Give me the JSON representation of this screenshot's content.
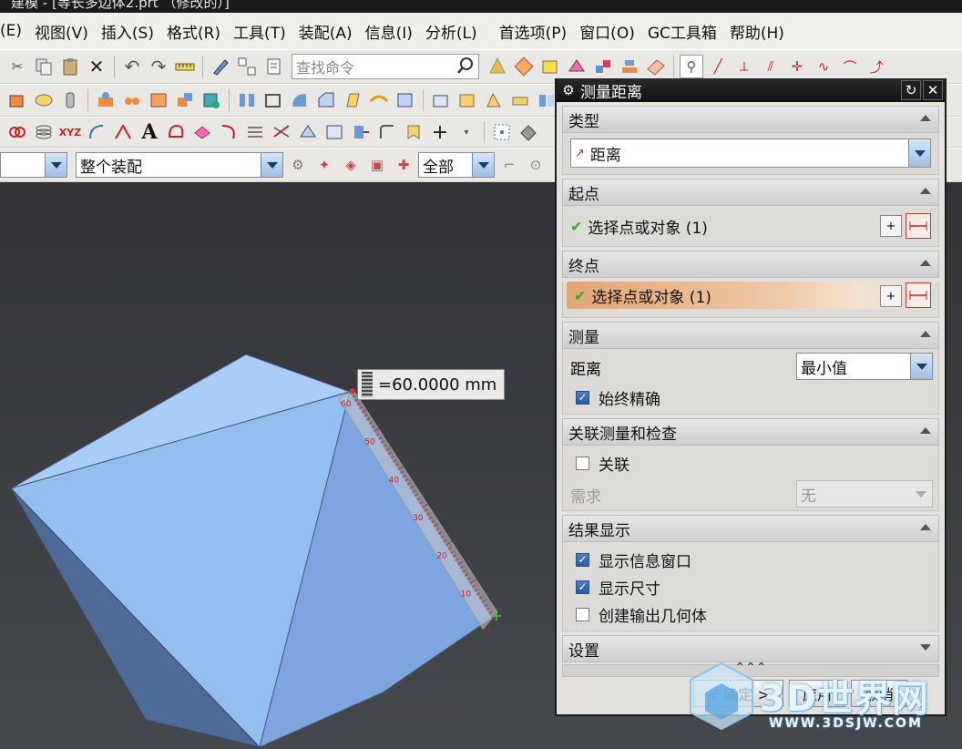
{
  "window": {
    "title": "建模 - [等长多边体2.prt （修改的）]"
  },
  "menu": [
    "(E)",
    "视图(V)",
    "插入(S)",
    "格式(R)",
    "工具(T)",
    "装配(A)",
    "信息(I)",
    "分析(L)",
    "首选项(P)",
    "窗口(O)",
    "GC工具箱",
    "帮助(H)"
  ],
  "toolbar": {
    "search_placeholder": "查找命令",
    "assembly_scope": "整个装配",
    "filter_value": "全部"
  },
  "dimension": {
    "label": "=60.0000 mm"
  },
  "ruler": {
    "ticks": [
      "60",
      "50",
      "40",
      "30",
      "20",
      "10",
      "0"
    ]
  },
  "dialog": {
    "title": "测量距离",
    "sections": {
      "type": {
        "header": "类型",
        "value": "距离"
      },
      "start": {
        "header": "起点",
        "select_label": "选择点或对象 (1)"
      },
      "end": {
        "header": "终点",
        "select_label": "选择点或对象 (1)"
      },
      "measure": {
        "header": "测量",
        "distance_label": "距离",
        "distance_value": "最小值",
        "always_precise": "始终精确"
      },
      "assoc": {
        "header": "关联测量和检查",
        "assoc_label": "关联",
        "require_label": "需求",
        "require_value": "无"
      },
      "result": {
        "header": "结果显示",
        "show_info": "显示信息窗口",
        "show_dim": "显示尺寸",
        "create_geom": "创建输出几何体"
      },
      "settings": {
        "header": "设置"
      }
    },
    "buttons": {
      "ok": "< 确定 >",
      "apply": "应用",
      "cancel": "取消"
    }
  },
  "watermark": {
    "brand": "3D世界网",
    "url": "WWW.3DSJW.COM"
  }
}
